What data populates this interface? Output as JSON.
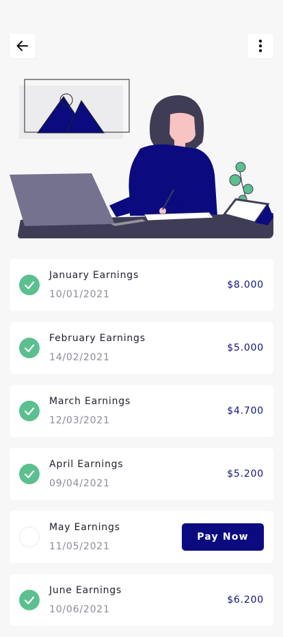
{
  "header": {
    "back_icon": "arrow-left-icon",
    "menu_icon": "more-vertical-icon"
  },
  "illustration": {
    "subject": "woman-working-at-laptop",
    "colors": {
      "accent": "#0b0b7f",
      "laptop": "#75728f",
      "desk": "#3f3d56",
      "skin": "#f8c3c3",
      "hair": "#3f3d56",
      "plant": "#5cbf8f"
    }
  },
  "earnings": [
    {
      "title": "January Earnings",
      "date": "10/01/2021",
      "amount": "$8.000",
      "paid": true
    },
    {
      "title": "February Earnings",
      "date": "14/02/2021",
      "amount": "$5.000",
      "paid": true
    },
    {
      "title": "March Earnings",
      "date": "12/03/2021",
      "amount": "$4.700",
      "paid": true
    },
    {
      "title": "April Earnings",
      "date": "09/04/2021",
      "amount": "$5.200",
      "paid": true
    },
    {
      "title": "May Earnings",
      "date": "11/05/2021",
      "amount": "",
      "paid": false,
      "action": "Pay Now"
    },
    {
      "title": "June Earnings",
      "date": "10/06/2021",
      "amount": "$6.200",
      "paid": true
    }
  ],
  "colors": {
    "background": "#f7f7f8",
    "card": "#ffffff",
    "check": "#5cbf8f",
    "amount_text": "#12127a",
    "primary_button": "#0b0b7f"
  }
}
